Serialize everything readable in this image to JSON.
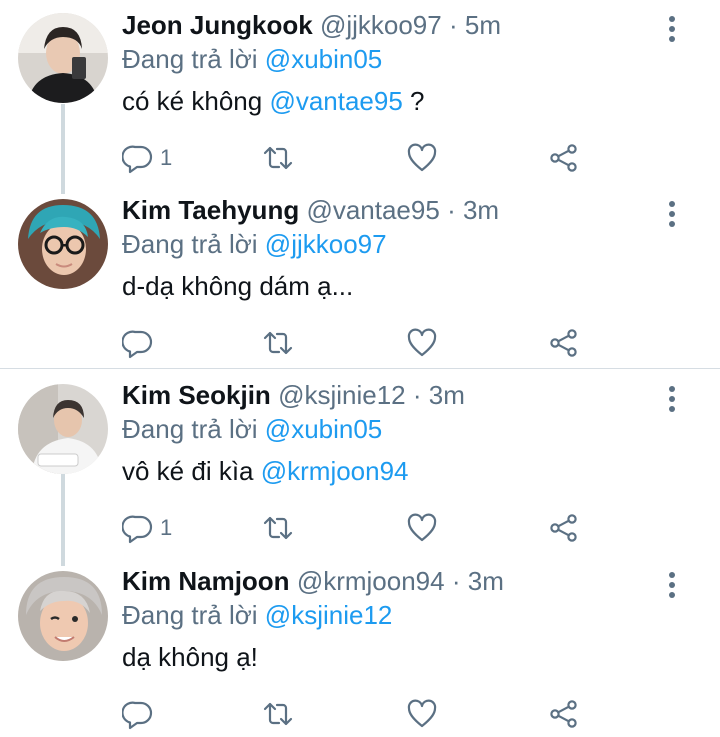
{
  "reply_prefix": "Đang trả lời",
  "tweets": [
    {
      "name": "Jeon Jungkook",
      "handle": "@jjkkoo97",
      "dot": "·",
      "time": "5m",
      "reply_to": "@xubin05",
      "text_before": "có ké không ",
      "text_mention": "@vantae95",
      "text_after": " ?",
      "reply_count": "1",
      "avatar_icon": "avatar-jungkook"
    },
    {
      "name": "Kim Taehyung",
      "handle": "@vantae95",
      "dot": "·",
      "time": "3m",
      "reply_to": "@jjkkoo97",
      "text_before": "d-dạ không dám ạ...",
      "text_mention": "",
      "text_after": "",
      "reply_count": "",
      "avatar_icon": "avatar-taehyung"
    },
    {
      "name": "Kim Seokjin",
      "handle": "@ksjinie12",
      "dot": "·",
      "time": "3m",
      "reply_to": "@xubin05",
      "text_before": "vô ké đi kìa ",
      "text_mention": "@krmjoon94",
      "text_after": "",
      "reply_count": "1",
      "avatar_icon": "avatar-seokjin"
    },
    {
      "name": "Kim Namjoon",
      "handle": "@krmjoon94",
      "dot": "·",
      "time": "3m",
      "reply_to": "@ksjinie12",
      "text_before": "dạ không ạ!",
      "text_mention": "",
      "text_after": "",
      "reply_count": "",
      "avatar_icon": "avatar-namjoon"
    }
  ],
  "colors": {
    "mention": "#1d9bf0",
    "secondary_text": "#5b7083",
    "primary_text": "#0f1419",
    "thread_line": "#cfd9de"
  }
}
